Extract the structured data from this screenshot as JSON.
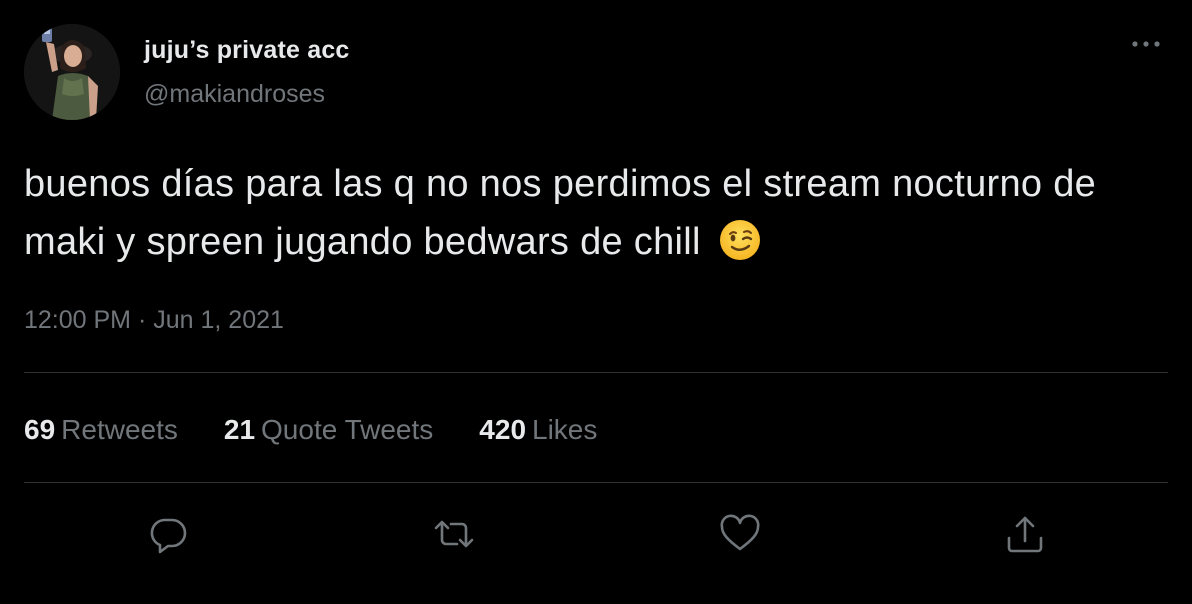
{
  "user": {
    "display_name": "juju’s private acc",
    "handle": "@makiandroses",
    "avatar_icon": "profile-photo"
  },
  "tweet": {
    "text": "buenos días para las q no nos perdimos el stream nocturno de maki y spreen jugando bedwars de chill",
    "emoji": "winking-face-icon",
    "time": "12:00 PM",
    "separator": "·",
    "date": "Jun 1, 2021"
  },
  "stats": {
    "retweets_count": "69",
    "retweets_label": "Retweets",
    "quotes_count": "21",
    "quotes_label": "Quote Tweets",
    "likes_count": "420",
    "likes_label": "Likes"
  },
  "actions": {
    "reply_icon": "reply-icon",
    "retweet_icon": "retweet-icon",
    "like_icon": "heart-icon",
    "share_icon": "share-icon"
  },
  "colors": {
    "background": "#000000",
    "primary_text": "#e7e9ea",
    "secondary_text": "#71767b",
    "divider": "#2f3336"
  }
}
